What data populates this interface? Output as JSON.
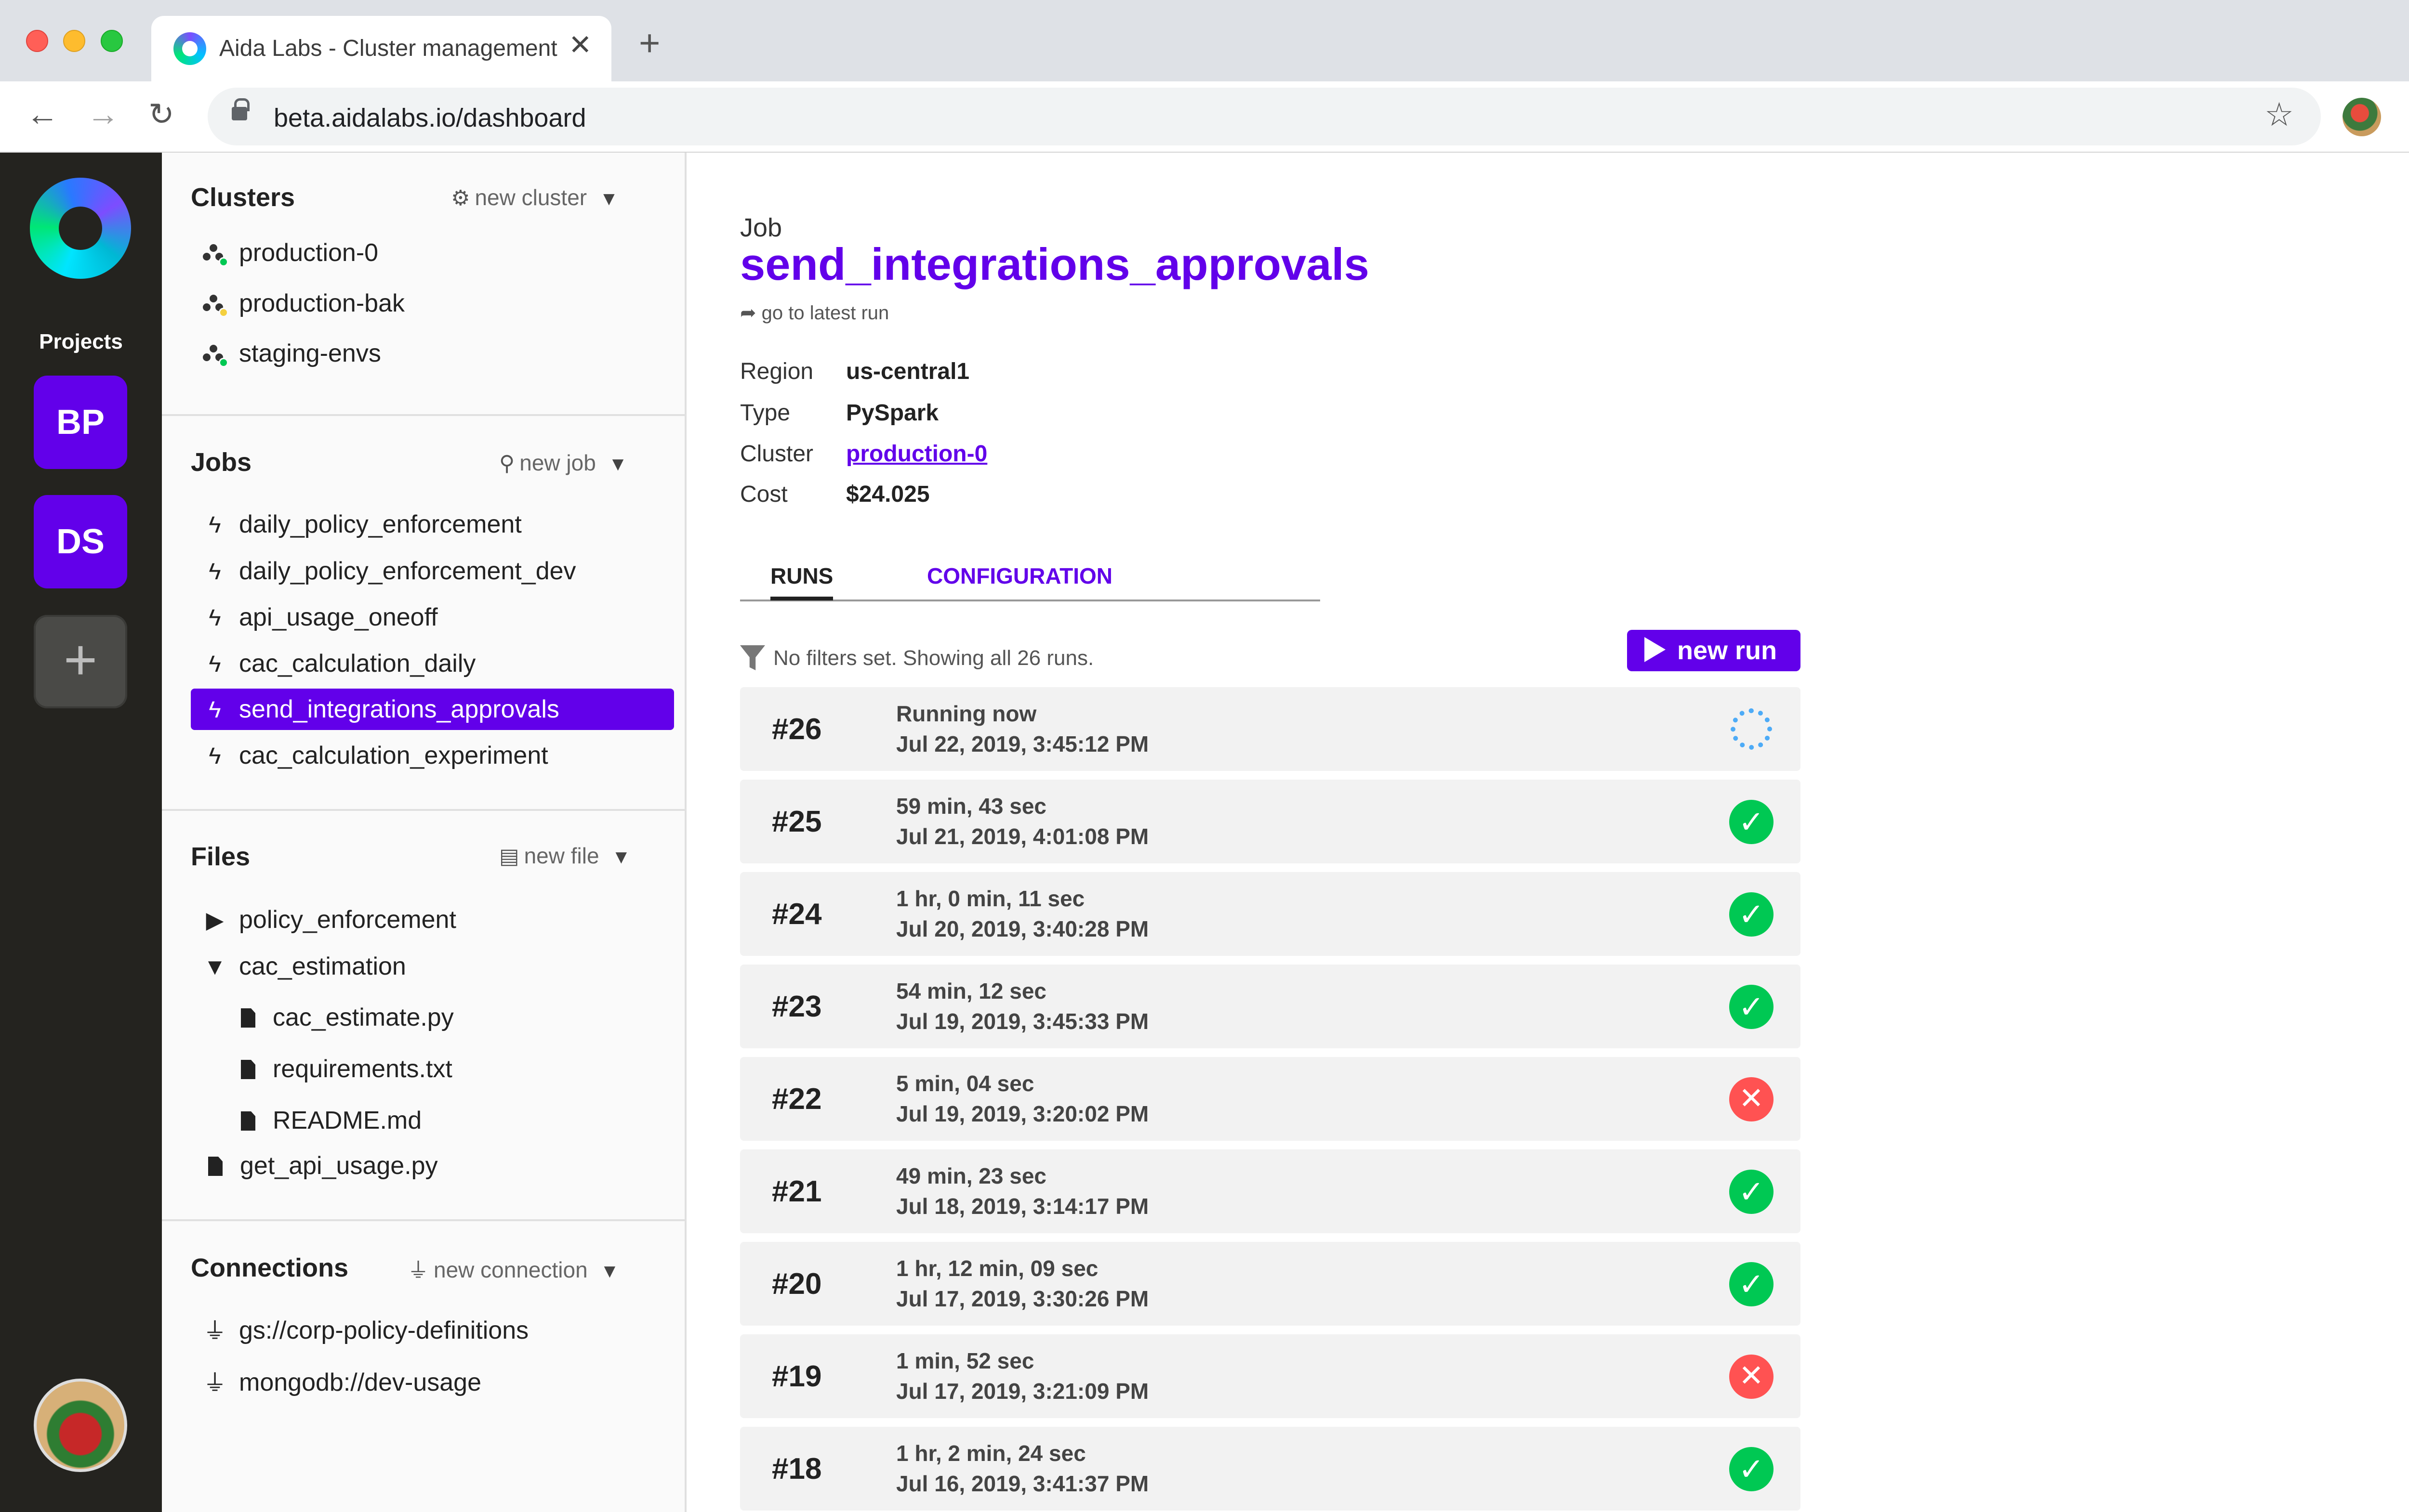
{
  "browser": {
    "tab_title": "Aida Labs - Cluster management",
    "tab_close": "✕",
    "new_tab": "+",
    "url": "beta.aidalabs.io/dashboard",
    "icons": [
      "back-arrow-icon",
      "forward-arrow-icon",
      "reload-icon",
      "lock-icon",
      "star-icon",
      "profile-avatar",
      "kebab-menu-icon"
    ]
  },
  "rail": {
    "projects_label": "Projects",
    "projects": [
      {
        "initials": "BP"
      },
      {
        "initials": "DS"
      }
    ],
    "add_label": "+",
    "accent_color": "#6200ea"
  },
  "sidebar": {
    "clusters": {
      "title": "Clusters",
      "action": "new cluster",
      "items": [
        {
          "label": "production-0",
          "status_color": "#00c853"
        },
        {
          "label": "production-bak",
          "status_color": "#f4d03f"
        },
        {
          "label": "staging-envs",
          "status_color": "#00c853"
        }
      ]
    },
    "jobs": {
      "title": "Jobs",
      "action": "new job",
      "items": [
        {
          "label": "daily_policy_enforcement"
        },
        {
          "label": "daily_policy_enforcement_dev"
        },
        {
          "label": "api_usage_oneoff"
        },
        {
          "label": "cac_calculation_daily"
        },
        {
          "label": "send_integrations_approvals",
          "active": true
        },
        {
          "label": "cac_calculation_experiment"
        }
      ]
    },
    "files": {
      "title": "Files",
      "action": "new file",
      "items": [
        {
          "label": "policy_enforcement",
          "type": "folder-collapsed"
        },
        {
          "label": "cac_estimation",
          "type": "folder-expanded"
        },
        {
          "label": "cac_estimate.py",
          "type": "file",
          "indent": 1
        },
        {
          "label": "requirements.txt",
          "type": "file",
          "indent": 1
        },
        {
          "label": "README.md",
          "type": "file",
          "indent": 1
        },
        {
          "label": "get_api_usage.py",
          "type": "file"
        }
      ]
    },
    "connections": {
      "title": "Connections",
      "action": "new connection",
      "items": [
        {
          "label": "gs://corp-policy-definitions"
        },
        {
          "label": "mongodb://dev-usage"
        }
      ]
    }
  },
  "main": {
    "job_label": "Job",
    "job_name": "send_integrations_approvals",
    "latest_run_link": "go to latest run",
    "meta": {
      "region_label": "Region",
      "region": "us-central1",
      "type_label": "Type",
      "type": "PySpark",
      "cluster_label": "Cluster",
      "cluster": "production-0",
      "cost_label": "Cost",
      "cost": "$24.025"
    },
    "tabs": {
      "runs": "RUNS",
      "configuration": "CONFIGURATION",
      "active": "RUNS"
    },
    "filter_text": "No filters set. Showing all 26 runs.",
    "new_run_label": "new run",
    "runs": [
      {
        "num": "#26",
        "duration": "Running now",
        "date": "Jul 22, 2019, 3:45:12 PM",
        "status": "running"
      },
      {
        "num": "#25",
        "duration": "59 min, 43 sec",
        "date": "Jul 21, 2019, 4:01:08 PM",
        "status": "success"
      },
      {
        "num": "#24",
        "duration": "1 hr, 0 min, 11 sec",
        "date": "Jul 20, 2019, 3:40:28 PM",
        "status": "success"
      },
      {
        "num": "#23",
        "duration": "54 min, 12 sec",
        "date": "Jul 19, 2019, 3:45:33 PM",
        "status": "success"
      },
      {
        "num": "#22",
        "duration": "5 min, 04 sec",
        "date": "Jul 19, 2019, 3:20:02 PM",
        "status": "failed"
      },
      {
        "num": "#21",
        "duration": "49 min, 23 sec",
        "date": "Jul 18, 2019, 3:14:17 PM",
        "status": "success"
      },
      {
        "num": "#20",
        "duration": "1 hr, 12 min, 09 sec",
        "date": "Jul 17, 2019, 3:30:26 PM",
        "status": "success"
      },
      {
        "num": "#19",
        "duration": "1 min, 52 sec",
        "date": "Jul 17, 2019, 3:21:09 PM",
        "status": "failed"
      },
      {
        "num": "#18",
        "duration": "1 hr, 2 min, 24 sec",
        "date": "Jul 16, 2019, 3:41:37 PM",
        "status": "success"
      }
    ],
    "status_colors": {
      "success": "#00c853",
      "failed": "#ff5252",
      "running": "#4dabf7"
    }
  }
}
